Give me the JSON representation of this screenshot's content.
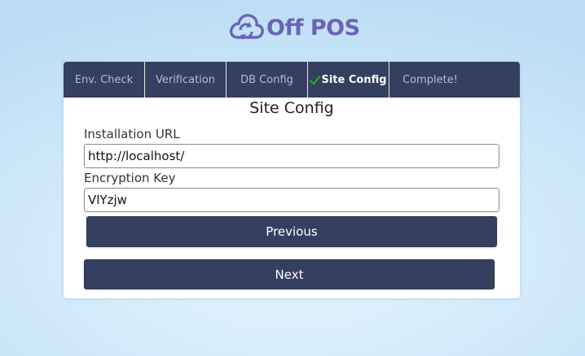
{
  "app": {
    "brand": "Off POS",
    "logo_icon": "cloud-sync-icon"
  },
  "colors": {
    "brand": "#6c63b5",
    "nav_background": "#353f60",
    "button_background": "#353f60",
    "check": "#2e9e3e"
  },
  "tabs": [
    {
      "label": "Env. Check",
      "state": "inactive"
    },
    {
      "label": "Verification",
      "state": "inactive"
    },
    {
      "label": "DB Config",
      "state": "inactive"
    },
    {
      "label": "Site Config",
      "state": "active",
      "icon": "check-icon"
    },
    {
      "label": "Complete!",
      "state": "inactive"
    }
  ],
  "form": {
    "title": "Site Config",
    "installation_url": {
      "label": "Installation URL",
      "value": "http://localhost/"
    },
    "encryption_key": {
      "label": "Encryption Key",
      "value": "VlYzjw"
    },
    "previous_label": "Previous",
    "next_label": "Next"
  }
}
